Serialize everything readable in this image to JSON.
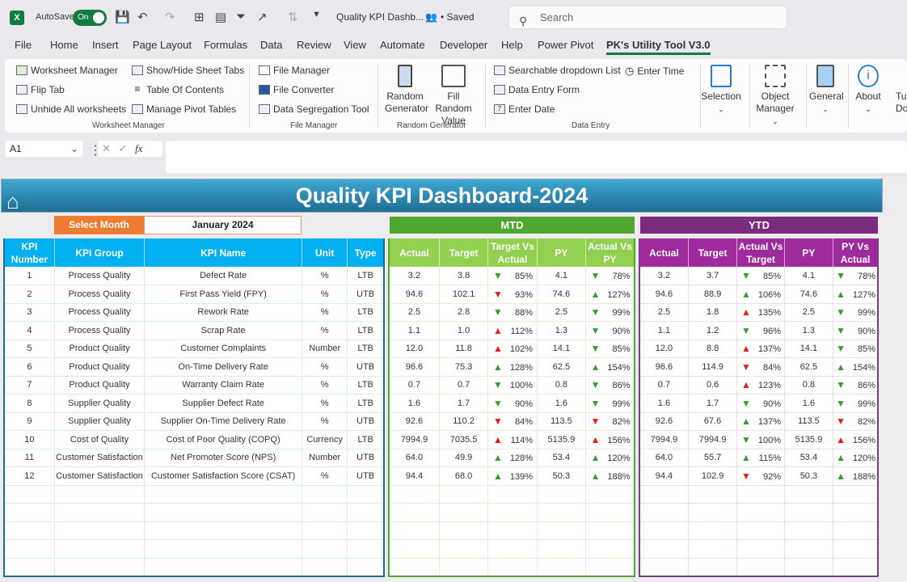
{
  "titlebar": {
    "app_icon": "excel-icon",
    "autosave_label": "AutoSave",
    "autosave_state": "On",
    "doc_title": "Quality KPI Dashb...",
    "saved_status": "• Saved",
    "search_placeholder": "Search"
  },
  "menu": [
    "File",
    "Home",
    "Insert",
    "Page Layout",
    "Formulas",
    "Data",
    "Review",
    "View",
    "Automate",
    "Developer",
    "Help",
    "Power Pivot",
    "PK's Utility Tool V3.0"
  ],
  "active_menu": "PK's Utility Tool V3.0",
  "ribbon": {
    "worksheet_manager": {
      "group_label": "Worksheet Manager",
      "items": [
        "Worksheet Manager",
        "Flip Tab",
        "Unhide All worksheets",
        "Show/Hide Sheet Tabs",
        "Table Of Contents",
        "Manage Pivot Tables"
      ]
    },
    "file_manager": {
      "group_label": "File Manager",
      "items": [
        "File Manager",
        "File Converter",
        "Data Segregation Tool"
      ]
    },
    "random_generator": {
      "group_label": "Random Generator",
      "items": [
        "Random Generator",
        "Fill Random Value"
      ]
    },
    "data_entry": {
      "group_label": "Data Entry",
      "items": [
        "Searchable dropdown List",
        "Data Entry Form",
        "Enter Date",
        "Enter Time"
      ]
    },
    "big_buttons": [
      "Selection",
      "Object Manager",
      "General",
      "About",
      "Tu Do"
    ]
  },
  "formula_bar": {
    "name_box": "A1",
    "fx": "fx",
    "content": ""
  },
  "dashboard": {
    "title": "Quality KPI Dashboard-2024",
    "select_month_label": "Select Month",
    "select_month_value": "January 2024",
    "mtd_label": "MTD",
    "ytd_label": "YTD",
    "main_headers": [
      "KPI Number",
      "KPI Group",
      "KPI Name",
      "Unit",
      "Type"
    ],
    "mtd_headers": [
      "Actual",
      "Target",
      "Target Vs Actual",
      "PY",
      "Actual Vs PY"
    ],
    "ytd_headers": [
      "Actual",
      "Target",
      "Actual Vs Target",
      "PY",
      "PY Vs Actual"
    ],
    "rows": [
      {
        "num": "1",
        "group": "Process Quality",
        "name": "Defect Rate",
        "unit": "%",
        "type": "LTB",
        "mtd": {
          "actual": "3.2",
          "target": "3.8",
          "tva": "85%",
          "tva_arrow": "down-green",
          "py": "4.1",
          "avp": "78%",
          "avp_arrow": "down-green"
        },
        "ytd": {
          "actual": "3.2",
          "target": "3.7",
          "avt": "85%",
          "avt_arrow": "down-green",
          "py": "4.1",
          "pva": "78%",
          "pva_arrow": "down-green"
        }
      },
      {
        "num": "2",
        "group": "Process Quality",
        "name": "First Pass Yield (FPY)",
        "unit": "%",
        "type": "UTB",
        "mtd": {
          "actual": "94.6",
          "target": "102.1",
          "tva": "93%",
          "tva_arrow": "down-red",
          "py": "74.6",
          "avp": "127%",
          "avp_arrow": "up-green"
        },
        "ytd": {
          "actual": "94.6",
          "target": "88.9",
          "avt": "106%",
          "avt_arrow": "up-green",
          "py": "74.6",
          "pva": "127%",
          "pva_arrow": "up-green"
        }
      },
      {
        "num": "3",
        "group": "Process Quality",
        "name": "Rework Rate",
        "unit": "%",
        "type": "LTB",
        "mtd": {
          "actual": "2.5",
          "target": "2.8",
          "tva": "88%",
          "tva_arrow": "down-green",
          "py": "2.5",
          "avp": "99%",
          "avp_arrow": "down-green"
        },
        "ytd": {
          "actual": "2.5",
          "target": "1.8",
          "avt": "135%",
          "avt_arrow": "up-red",
          "py": "2.5",
          "pva": "99%",
          "pva_arrow": "down-green"
        }
      },
      {
        "num": "4",
        "group": "Process Quality",
        "name": "Scrap Rate",
        "unit": "%",
        "type": "LTB",
        "mtd": {
          "actual": "1.1",
          "target": "1.0",
          "tva": "112%",
          "tva_arrow": "up-red",
          "py": "1.3",
          "avp": "90%",
          "avp_arrow": "down-green"
        },
        "ytd": {
          "actual": "1.1",
          "target": "1.2",
          "avt": "96%",
          "avt_arrow": "down-green",
          "py": "1.3",
          "pva": "90%",
          "pva_arrow": "down-green"
        }
      },
      {
        "num": "5",
        "group": "Product Quality",
        "name": "Customer Complaints",
        "unit": "Number",
        "type": "LTB",
        "mtd": {
          "actual": "12.0",
          "target": "11.8",
          "tva": "102%",
          "tva_arrow": "up-red",
          "py": "14.1",
          "avp": "85%",
          "avp_arrow": "down-green"
        },
        "ytd": {
          "actual": "12.0",
          "target": "8.8",
          "avt": "137%",
          "avt_arrow": "up-red",
          "py": "14.1",
          "pva": "85%",
          "pva_arrow": "down-green"
        }
      },
      {
        "num": "6",
        "group": "Product Quality",
        "name": "On-Time Delivery Rate",
        "unit": "%",
        "type": "UTB",
        "mtd": {
          "actual": "96.6",
          "target": "75.3",
          "tva": "128%",
          "tva_arrow": "up-green",
          "py": "62.5",
          "avp": "154%",
          "avp_arrow": "up-green"
        },
        "ytd": {
          "actual": "96.6",
          "target": "114.9",
          "avt": "84%",
          "avt_arrow": "down-red",
          "py": "62.5",
          "pva": "154%",
          "pva_arrow": "up-green"
        }
      },
      {
        "num": "7",
        "group": "Product Quality",
        "name": "Warranty Claim Rate",
        "unit": "%",
        "type": "LTB",
        "mtd": {
          "actual": "0.7",
          "target": "0.7",
          "tva": "100%",
          "tva_arrow": "down-green",
          "py": "0.8",
          "avp": "86%",
          "avp_arrow": "down-green"
        },
        "ytd": {
          "actual": "0.7",
          "target": "0.6",
          "avt": "123%",
          "avt_arrow": "up-red",
          "py": "0.8",
          "pva": "86%",
          "pva_arrow": "down-green"
        }
      },
      {
        "num": "8",
        "group": "Supplier Quality",
        "name": "Supplier Defect Rate",
        "unit": "%",
        "type": "LTB",
        "mtd": {
          "actual": "1.6",
          "target": "1.7",
          "tva": "90%",
          "tva_arrow": "down-green",
          "py": "1.6",
          "avp": "99%",
          "avp_arrow": "down-green"
        },
        "ytd": {
          "actual": "1.6",
          "target": "1.7",
          "avt": "90%",
          "avt_arrow": "down-green",
          "py": "1.6",
          "pva": "99%",
          "pva_arrow": "down-green"
        }
      },
      {
        "num": "9",
        "group": "Supplier Quality",
        "name": "Supplier On-Time Delivery Rate",
        "unit": "%",
        "type": "UTB",
        "mtd": {
          "actual": "92.6",
          "target": "110.2",
          "tva": "84%",
          "tva_arrow": "down-red",
          "py": "113.5",
          "avp": "82%",
          "avp_arrow": "down-red"
        },
        "ytd": {
          "actual": "92.6",
          "target": "67.6",
          "avt": "137%",
          "avt_arrow": "up-green",
          "py": "113.5",
          "pva": "82%",
          "pva_arrow": "down-red"
        }
      },
      {
        "num": "10",
        "group": "Cost of Quality",
        "name": "Cost of Poor Quality (COPQ)",
        "unit": "Currency",
        "type": "LTB",
        "mtd": {
          "actual": "7994.9",
          "target": "7035.5",
          "tva": "114%",
          "tva_arrow": "up-red",
          "py": "5135.9",
          "avp": "156%",
          "avp_arrow": "up-red"
        },
        "ytd": {
          "actual": "7994.9",
          "target": "7994.9",
          "avt": "100%",
          "avt_arrow": "down-green",
          "py": "5135.9",
          "pva": "156%",
          "pva_arrow": "up-red"
        }
      },
      {
        "num": "11",
        "group": "Customer Satisfaction",
        "name": "Net Promoter Score (NPS)",
        "unit": "Number",
        "type": "UTB",
        "mtd": {
          "actual": "64.0",
          "target": "49.9",
          "tva": "128%",
          "tva_arrow": "up-green",
          "py": "53.4",
          "avp": "120%",
          "avp_arrow": "up-green"
        },
        "ytd": {
          "actual": "64.0",
          "target": "55.7",
          "avt": "115%",
          "avt_arrow": "up-green",
          "py": "53.4",
          "pva": "120%",
          "pva_arrow": "up-green"
        }
      },
      {
        "num": "12",
        "group": "Customer Satisfaction",
        "name": "Customer Satisfaction Score (CSAT)",
        "unit": "%",
        "type": "UTB",
        "mtd": {
          "actual": "94.4",
          "target": "68.0",
          "tva": "139%",
          "tva_arrow": "up-green",
          "py": "50.3",
          "avp": "188%",
          "avp_arrow": "up-green"
        },
        "ytd": {
          "actual": "94.4",
          "target": "102.9",
          "avt": "92%",
          "avt_arrow": "down-red",
          "py": "50.3",
          "pva": "188%",
          "pva_arrow": "up-green"
        }
      }
    ],
    "empty_rows": 5
  },
  "colors": {
    "excel_green": "#107c41",
    "banner_top": "#3fa8d4",
    "banner_bottom": "#1f6d92",
    "select_month": "#ed7d31",
    "main_header": "#00b0f0",
    "mtd_section": "#4ea72e",
    "mtd_header": "#92d050",
    "ytd_section": "#7b2c7e",
    "ytd_header": "#9e2a9e",
    "arrow_green": "#3d9a35",
    "arrow_red": "#e02020"
  }
}
